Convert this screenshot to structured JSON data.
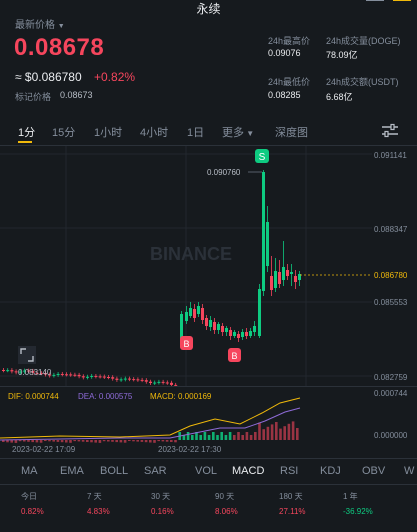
{
  "header": {
    "title": "永续",
    "latest_label": "最新价格",
    "price": "0.08678",
    "usd_price": "≈ $0.086780",
    "change": "+0.82%",
    "mark_label": "标记价格",
    "mark_value": "0.08673"
  },
  "stats": {
    "high_label": "24h最高价",
    "high_value": "0.09076",
    "low_label": "24h最低价",
    "low_value": "0.08285",
    "vol_label": "24h成交量(DOGE)",
    "vol_value": "78.09亿",
    "amt_label": "24h成交额(USDT)",
    "amt_value": "6.68亿"
  },
  "tabs": [
    "1分",
    "15分",
    "1小时",
    "4小时",
    "1日",
    "更多",
    "深度图"
  ],
  "chart": {
    "watermark": "BINANCE",
    "y_labels": [
      "0.091141",
      "0.088347",
      "0.086780",
      "0.085553",
      "0.082759"
    ],
    "peak_label": "0.090760",
    "low_label": "0.083140",
    "macd_axis": [
      "0.000744",
      "0.000000"
    ],
    "dif_label": "DIF: 0.000744",
    "dea_label": "DEA: 0.000575",
    "macd_label": "MACD: 0.000169",
    "date_1": "2023-02-22 17:09",
    "date_2": "2023-02-22 17:30",
    "marker_s": "S",
    "marker_b": "B"
  },
  "indicators": [
    "MA",
    "EMA",
    "BOLL",
    "SAR",
    "VOL",
    "MACD",
    "RSI",
    "KDJ",
    "OBV",
    "W"
  ],
  "performance": [
    {
      "label": "今日",
      "value": "0.82%"
    },
    {
      "label": "7 天",
      "value": "4.83%"
    },
    {
      "label": "30 天",
      "value": "0.16%"
    },
    {
      "label": "90 天",
      "value": "8.06%"
    },
    {
      "label": "180 天",
      "value": "27.11%"
    },
    {
      "label": "1 年",
      "value": "-36.92%"
    }
  ],
  "colors": {
    "up": "#0ecb81",
    "down": "#f6465d",
    "accent": "#f0b90b"
  }
}
